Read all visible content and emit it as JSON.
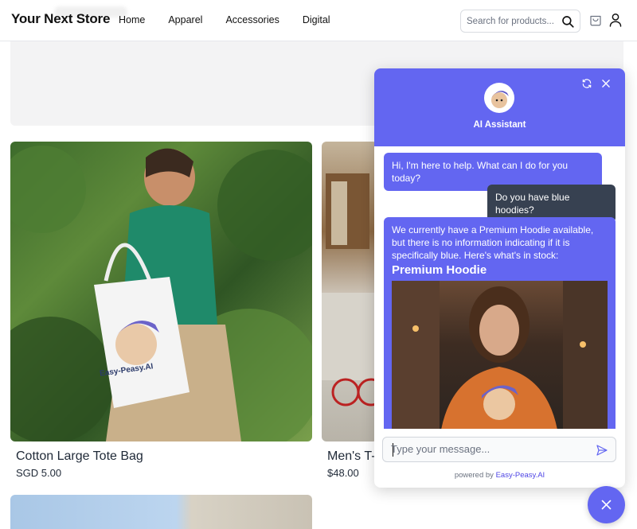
{
  "header": {
    "brand": "Your Next Store",
    "nav": [
      "Home",
      "Apparel",
      "Accessories",
      "Digital"
    ],
    "search_placeholder": "Search for products..."
  },
  "products": [
    {
      "name": "Cotton Large Tote Bag",
      "price": "SGD 5.00"
    },
    {
      "name": "Men's T-",
      "price": "$48.00"
    }
  ],
  "chat": {
    "title": "AI Assistant",
    "messages": [
      {
        "role": "bot",
        "text": "Hi, I'm here to help. What can I do for you today?"
      },
      {
        "role": "user",
        "text": "Do you have blue hoodies?"
      },
      {
        "role": "bot",
        "text": "We currently have a Premium Hoodie available, but there is no information indicating if it is specifically blue. Here's what's in stock:",
        "product_title": "Premium Hoodie"
      }
    ],
    "input_placeholder": "Type your message...",
    "powered_prefix": "powered by",
    "powered_brand": "Easy-Peasy.AI"
  },
  "branding": {
    "logo_text": "Easy-Peasy.AI"
  },
  "colors": {
    "accent": "#6366f1",
    "user_bubble": "#374151"
  }
}
